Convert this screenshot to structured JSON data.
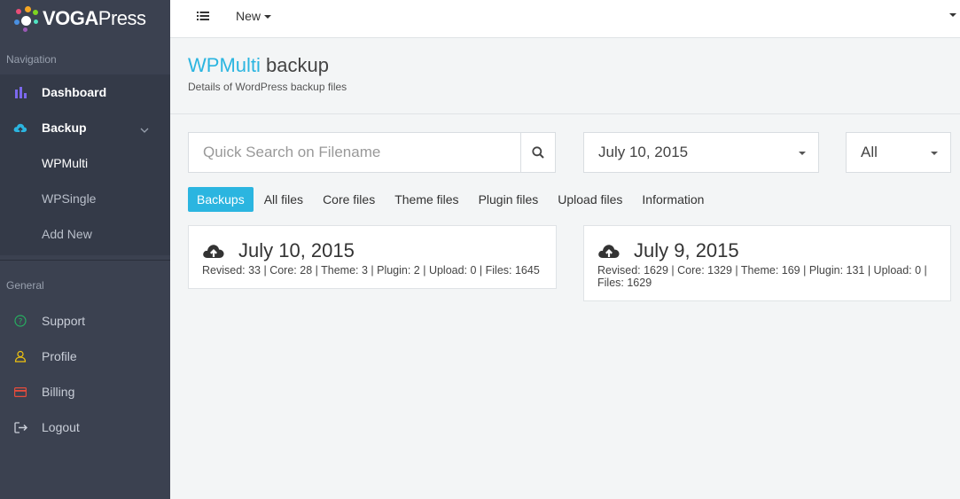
{
  "brand": {
    "name_part1": "VOGA",
    "name_part2": "Press",
    "dot_colors": [
      "#e94e77",
      "#f5a623",
      "#7ed321",
      "#4a90e2",
      "#9b59b6",
      "#50e3c2"
    ]
  },
  "sidebar": {
    "navigation_header": "Navigation",
    "items": [
      {
        "label": "Dashboard",
        "icon": "bar-chart-icon",
        "color": "#7b68ee"
      },
      {
        "label": "Backup",
        "icon": "cloud-upload-icon",
        "color": "#2bb5e0"
      }
    ],
    "backup_sub": [
      "WPMulti",
      "WPSingle",
      "Add New"
    ],
    "general_header": "General",
    "general_items": [
      {
        "label": "Support",
        "icon": "help-circle-icon",
        "color": "#27ae60"
      },
      {
        "label": "Profile",
        "icon": "user-icon",
        "color": "#f1c40f"
      },
      {
        "label": "Billing",
        "icon": "credit-card-icon",
        "color": "#e74c3c"
      },
      {
        "label": "Logout",
        "icon": "logout-icon",
        "color": "#c9ced8"
      }
    ]
  },
  "topbar": {
    "new_label": "New"
  },
  "page": {
    "title_accent": "WPMulti",
    "title_rest": " backup",
    "subtitle": "Details of WordPress backup files"
  },
  "search": {
    "placeholder": "Quick Search on Filename"
  },
  "filters": {
    "date_value": "July 10, 2015",
    "type_value": "All"
  },
  "tabs": [
    "Backups",
    "All files",
    "Core files",
    "Theme files",
    "Plugin files",
    "Upload files",
    "Information"
  ],
  "accent_color": "#2bb5e0",
  "backups": [
    {
      "date": "July 10, 2015",
      "stats": "Revised: 33 | Core: 28 | Theme: 3 | Plugin: 2 | Upload: 0 | Files: 1645"
    },
    {
      "date": "July 9, 2015",
      "stats_line1": "Revised: 1629 | Core: 1329 | Theme: 169 | Plugin: 131 | Upload: 0 |",
      "stats_line2": "Files: 1629"
    }
  ]
}
